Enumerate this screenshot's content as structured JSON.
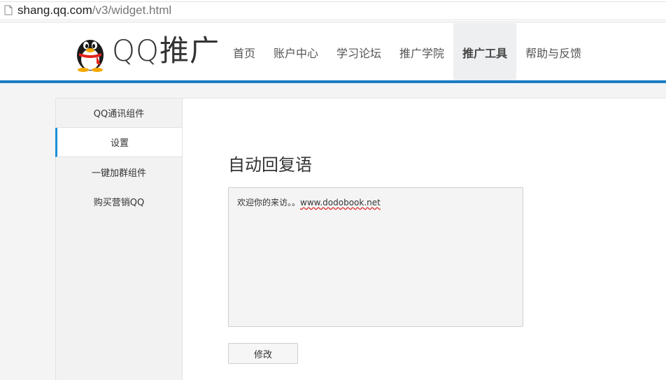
{
  "browser": {
    "url_host": "shang.qq.com",
    "url_path": "/v3/widget.html"
  },
  "header": {
    "logo_text": "QQ推广",
    "logo_icon": "qq-penguin-icon",
    "nav": [
      {
        "label": "首页",
        "active": false
      },
      {
        "label": "账户中心",
        "active": false
      },
      {
        "label": "学习论坛",
        "active": false
      },
      {
        "label": "推广学院",
        "active": false
      },
      {
        "label": "推广工具",
        "active": true
      },
      {
        "label": "帮助与反馈",
        "active": false
      }
    ]
  },
  "sidebar": {
    "items": [
      {
        "label": "QQ通讯组件",
        "active": false
      },
      {
        "label": "设置",
        "active": true
      },
      {
        "label": "一键加群组件",
        "active": false
      },
      {
        "label": "购买营销QQ",
        "active": false
      }
    ]
  },
  "main": {
    "title": "自动回复语",
    "reply_prefix": "欢迎你的来访。。",
    "reply_link": "www.dodobook.net",
    "edit_button": "修改"
  },
  "colors": {
    "accent": "#1a7dc4",
    "sidebar_active_bar": "#1a8fd6",
    "nav_active_bg": "#eeeff1"
  }
}
